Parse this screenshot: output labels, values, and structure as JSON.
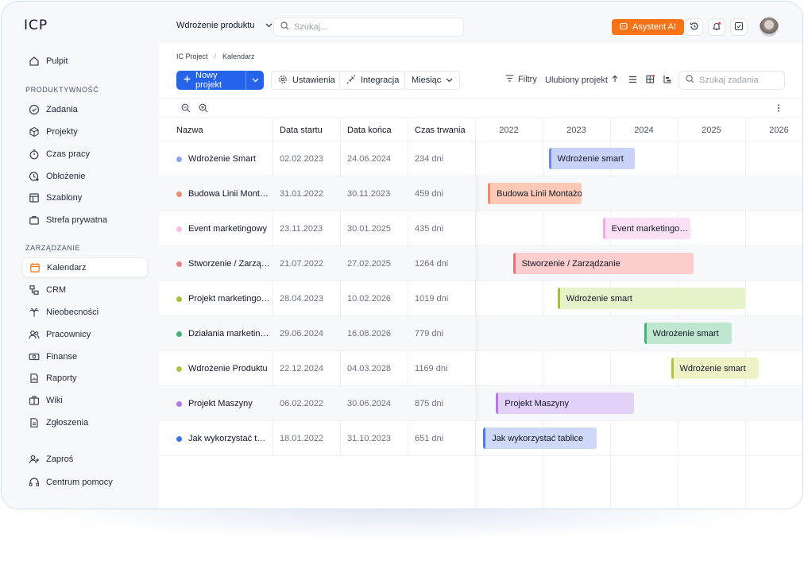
{
  "app": {
    "logo": "ICP"
  },
  "sidebar": {
    "pulpit": "Pulpit",
    "section_productivity": "PRODUKTYWNOŚĆ",
    "zadania": "Zadania",
    "projekty": "Projekty",
    "czas_pracy": "Czas pracy",
    "oblozenie": "Obłożenie",
    "szablony": "Szablony",
    "strefa": "Strefa prywatna",
    "section_management": "ZARZĄDZANIE",
    "kalendarz": "Kalendarz",
    "crm": "CRM",
    "nieobecnosci": "Nieobecności",
    "pracownicy": "Pracownicy",
    "finanse": "Finanse",
    "raporty": "Raporty",
    "wiki": "Wiki",
    "zgloszenia": "Zgłoszenia",
    "zapros": "Zaproś",
    "pomoc": "Centrum pomocy"
  },
  "topbar": {
    "project": "Wdrożenie produktu",
    "search_placeholder": "Szukaj...",
    "ai_label": "Asystent AI"
  },
  "breadcrumb": {
    "root": "IC Project",
    "sep": "/",
    "current": "Kalendarz"
  },
  "toolbar": {
    "new_project": "Nowy projekt",
    "settings": "Ustawienia",
    "integration": "Integracja",
    "range": "Miesiąc",
    "filters": "Filtry",
    "favorite": "Ulubiony projekt",
    "task_search_placeholder": "Szukaj zadania"
  },
  "table": {
    "columns": [
      "Nazwa",
      "Data startu",
      "Data końca",
      "Czas trwania"
    ],
    "years": [
      "2022",
      "2023",
      "2024",
      "2025",
      "2026"
    ],
    "rows": [
      {
        "name": "Wdrożenie Smart",
        "start": "02.02.2023",
        "end": "24.06.2024",
        "duration": "234 dni",
        "dot": "#8ea3f5",
        "bar_label": "Wdrożenie smart",
        "bar_bg": "#c9d3f7",
        "bar_accent": "#6d86ee",
        "bar_start": 2023.09,
        "bar_end": 2024.36
      },
      {
        "name": "Budowa Linii Mont…",
        "start": "31.01.2022",
        "end": "30.11.2023",
        "duration": "459 dni",
        "dot": "#f08a6a",
        "bar_label": "Budowa Linii Montażowe",
        "bar_bg": "#fbc9b6",
        "bar_accent": "#f08a6a",
        "bar_start": 2022.19,
        "bar_end": 2023.58
      },
      {
        "name": "Event marketingowy",
        "start": "23.11.2023",
        "end": "30.01.2025",
        "duration": "435 dni",
        "dot": "#f6b7ea",
        "bar_label": "Event marketingo…",
        "bar_bg": "#fbe0f6",
        "bar_accent": "#f2a8e4",
        "bar_start": 2023.89,
        "bar_end": 2025.19
      },
      {
        "name": "Stworzenie / Zarzą…",
        "start": "21.07.2022",
        "end": "27.02.2025",
        "duration": "1264 dni",
        "dot": "#ef7f86",
        "bar_label": "Stworzenie / Zarządzanie",
        "bar_bg": "#fbcdcd",
        "bar_accent": "#ea6e78",
        "bar_start": 2022.56,
        "bar_end": 2025.24
      },
      {
        "name": "Projekt marketingo…",
        "start": "28.04.2023",
        "end": "10.02.2026",
        "duration": "1019 dni",
        "dot": "#a3c13f",
        "bar_label": "Wdrożenie smart",
        "bar_bg": "#e6f2c8",
        "bar_accent": "#a3c13f",
        "bar_start": 2023.22,
        "bar_end": 2026.0
      },
      {
        "name": "Działania marketin…",
        "start": "29.06.2024",
        "end": "16.08.2026",
        "duration": "779 dni",
        "dot": "#3fb57a",
        "bar_label": "Wdrożenie smart",
        "bar_bg": "#bfe6cf",
        "bar_accent": "#3fb57a",
        "bar_start": 2024.5,
        "bar_end": 2025.8
      },
      {
        "name": "Wdrożenie Produktu",
        "start": "22.12.2024",
        "end": "04.03.2028",
        "duration": "1169 dni",
        "dot": "#b7c13f",
        "bar_label": "Wdrożenie smart",
        "bar_bg": "#eef2c6",
        "bar_accent": "#b8c13f",
        "bar_start": 2024.9,
        "bar_end": 2026.2
      },
      {
        "name": "Projekt Maszyny",
        "start": "06.02.2022",
        "end": "30.06.2024",
        "duration": "875 dni",
        "dot": "#b478ea",
        "bar_label": "Projekt Maszyny",
        "bar_bg": "#e3d2f7",
        "bar_accent": "#b478ea",
        "bar_start": 2022.31,
        "bar_end": 2024.35
      },
      {
        "name": "Jak wykorzystać t…",
        "start": "18.01.2022",
        "end": "31.10.2023",
        "duration": "651 dni",
        "dot": "#3b73e8",
        "bar_label": "Jak wykorzystać tablice",
        "bar_bg": "#cdd9f6",
        "bar_accent": "#4e7fe9",
        "bar_start": 2022.12,
        "bar_end": 2023.8
      }
    ]
  },
  "colors": {
    "primary": "#2563eb",
    "ai": "#f97316",
    "frame": "#cfe0f5"
  }
}
